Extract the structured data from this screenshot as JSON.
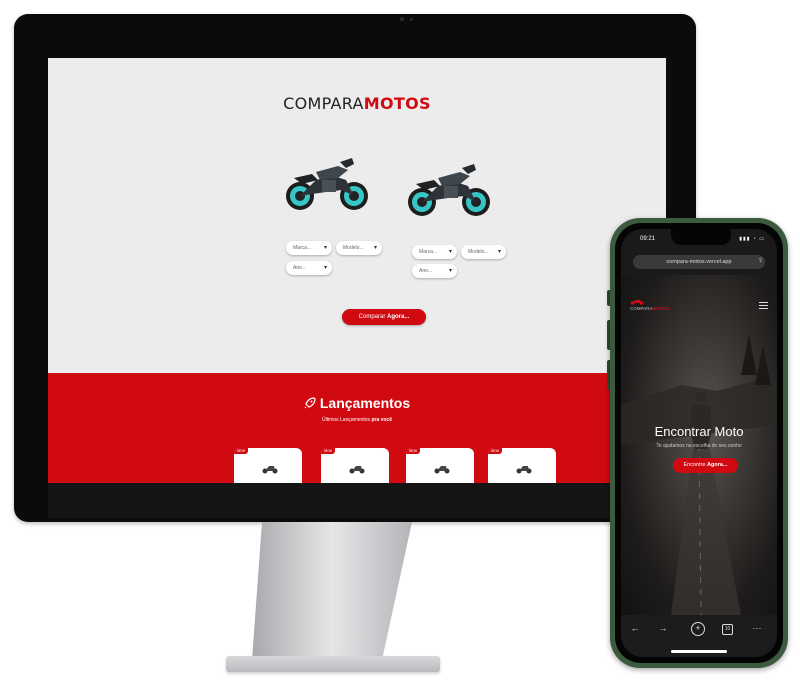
{
  "desktop": {
    "logo": {
      "part1": "COMPARA",
      "part2": "MOTOS"
    },
    "selectors": {
      "left": [
        "Marca...",
        "Modelo...",
        "Ano..."
      ],
      "right": [
        "Marca...",
        "Modelo...",
        "Ano..."
      ]
    },
    "compare_button": {
      "label": "Comparar ",
      "label_bold": "Agora..."
    },
    "launches": {
      "icon": "rocket-icon",
      "title": "Lançamentos",
      "subtitle": "Últimos Lançamentos",
      "subtitle_bold": "pra você",
      "badge": "NEW"
    },
    "colors": {
      "accent": "#d10a11",
      "background": "#ececed"
    }
  },
  "phone": {
    "time": "09:21",
    "url": "compara-motos.vercel.app",
    "logo": {
      "part1": "COMPARA",
      "part2": "MOTOS"
    },
    "hero_title": "Encontrar Moto",
    "hero_subtitle": "Te ajudamos na escolha do seu sonho",
    "cta": {
      "label": "Encontre ",
      "label_bold": "Agora..."
    },
    "toolbar_icons": [
      "back-arrow-icon",
      "forward-arrow-icon",
      "plus-icon",
      "tabs-icon",
      "more-icon"
    ],
    "tabs_count": "10"
  }
}
